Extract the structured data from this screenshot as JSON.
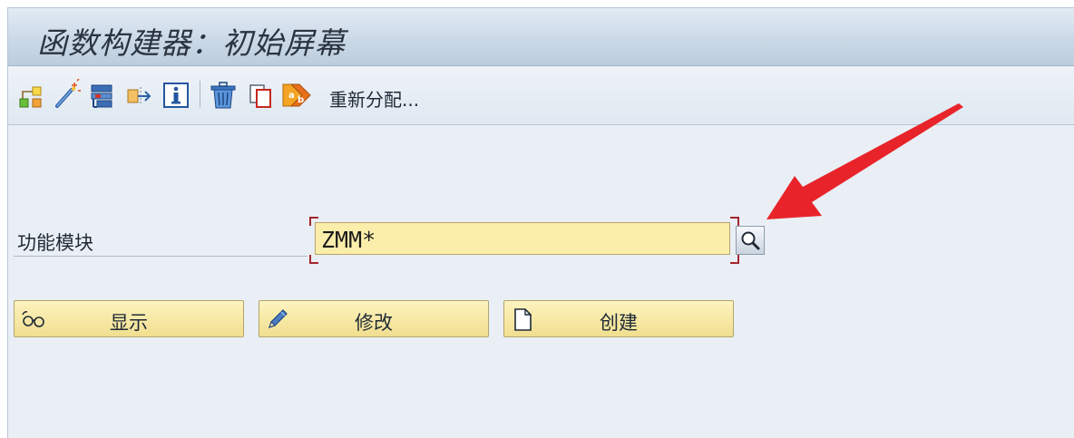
{
  "window": {
    "title": "函数构建器：初始屏幕"
  },
  "toolbar": {
    "icons": [
      "object-list-icon",
      "wizard-wand-icon",
      "where-used-icon",
      "transport-icon",
      "information-icon",
      "delete-trash-icon",
      "copy-icon",
      "rename-icon"
    ],
    "reassign_label": "重新分配..."
  },
  "form": {
    "function_module_label": "功能模块",
    "function_module_value": "ZMM*"
  },
  "actions": {
    "display_label": "显示",
    "change_label": "修改",
    "create_label": "创建"
  },
  "colors": {
    "input_bg": "#fbeeaa",
    "button_bg": "#f5e6a4",
    "required_marker": "#a4262c",
    "annotation_arrow": "#e8242a"
  }
}
